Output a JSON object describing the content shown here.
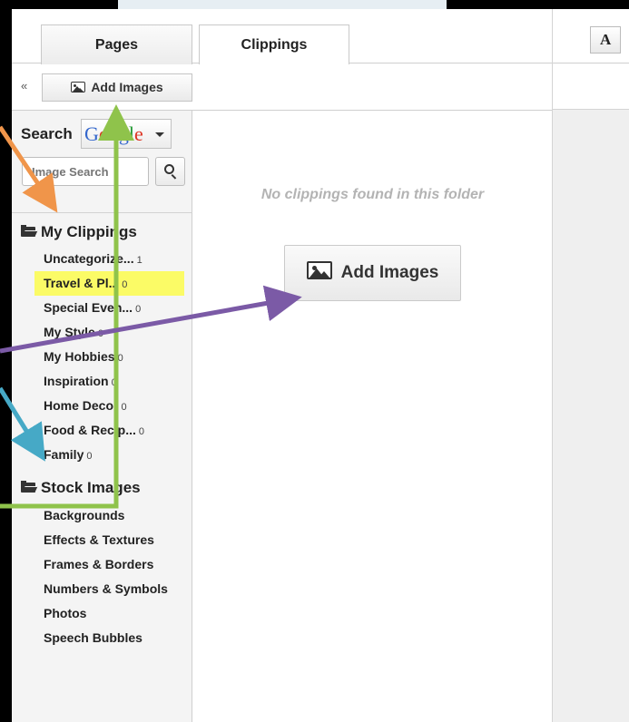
{
  "tabs": [
    {
      "label": "Pages"
    },
    {
      "label": "Clippings"
    }
  ],
  "toolbar": {
    "collapse_label": "«",
    "add_images_label": "Add Images"
  },
  "right_panel": {
    "font_button_label": "A"
  },
  "search": {
    "label": "Search",
    "provider": "Google",
    "placeholder": "Image Search"
  },
  "my_clippings": {
    "title": "My Clippings",
    "items": [
      {
        "label": "Uncategorize...",
        "count": "1"
      },
      {
        "label": "Travel & Pl...",
        "count": "0",
        "selected": true
      },
      {
        "label": "Special Even...",
        "count": "0"
      },
      {
        "label": "My Style",
        "count": "0"
      },
      {
        "label": "My Hobbies",
        "count": "0"
      },
      {
        "label": "Inspiration",
        "count": "0"
      },
      {
        "label": "Home Decor",
        "count": "0"
      },
      {
        "label": "Food & Recip...",
        "count": "0"
      },
      {
        "label": "Family",
        "count": "0"
      }
    ]
  },
  "stock_images": {
    "title": "Stock Images",
    "items": [
      {
        "label": "Backgrounds"
      },
      {
        "label": "Effects & Textures"
      },
      {
        "label": "Frames & Borders"
      },
      {
        "label": "Numbers & Symbols"
      },
      {
        "label": "Photos"
      },
      {
        "label": "Speech Bubbles"
      }
    ]
  },
  "content": {
    "empty_message": "No clippings found in this folder",
    "add_images_label": "Add Images"
  },
  "icons": {
    "add_images": "image-icon",
    "folder": "folder-open-icon",
    "search": "search-icon",
    "dropdown": "caret-down-icon"
  },
  "colors": {
    "selected_highlight": "#fbfb66",
    "arrow_orange": "#f0954a",
    "arrow_green": "#8fc34b",
    "arrow_purple": "#7b5aa6",
    "arrow_blue": "#46a9c6"
  }
}
